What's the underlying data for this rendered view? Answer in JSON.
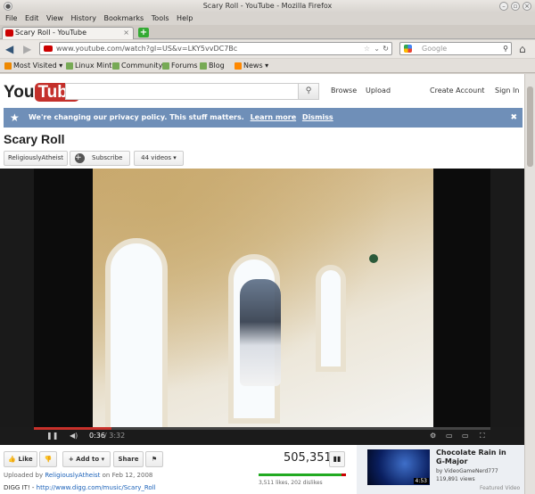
{
  "window": {
    "title": "Scary Roll - YouTube - Mozilla Firefox"
  },
  "menu": [
    "File",
    "Edit",
    "View",
    "History",
    "Bookmarks",
    "Tools",
    "Help"
  ],
  "tab": {
    "label": "Scary Roll - YouTube"
  },
  "url": "www.youtube.com/watch?gl=US&v=LKY5vvDC7Bc",
  "search_placeholder": "Google",
  "bookmarks": [
    "Most Visited ▾",
    "Linux Mint",
    "Community",
    "Forums",
    "Blog",
    "News ▾"
  ],
  "yt": {
    "logo_you": "You",
    "logo_tube": "Tube",
    "browse": "Browse",
    "upload": "Upload",
    "create_account": "Create Account",
    "sign_in": "Sign In",
    "notice": "We're changing our privacy policy. This stuff matters.",
    "learn_more": "Learn more",
    "dismiss": "Dismiss"
  },
  "video": {
    "title": "Scary Roll",
    "channel": "ReligiouslyAtheist",
    "subscribe": "Subscribe",
    "video_count": "44 videos ▾",
    "time_current": "0:36",
    "time_total": "/ 3:32",
    "progress": 0.17,
    "views": "505,351",
    "likes_text": "3,511 likes, 202 dislikes",
    "like_ratio": 0.95,
    "uploaded_prefix": "Uploaded by",
    "uploader": "ReligiouslyAtheist",
    "uploaded_date": "on Feb 12, 2008",
    "desc_prefix": "DIGG IT! -",
    "desc_link": "http://www.digg.com/music/Scary_Roll",
    "like_label": "Like",
    "add_to": "Add to ▾",
    "share": "Share"
  },
  "featured": {
    "title": "Chocolate Rain in G-Major",
    "by": "by VideoGameNerd777",
    "views": "119,891 views",
    "duration": "4:53",
    "label": "Featured Video"
  }
}
